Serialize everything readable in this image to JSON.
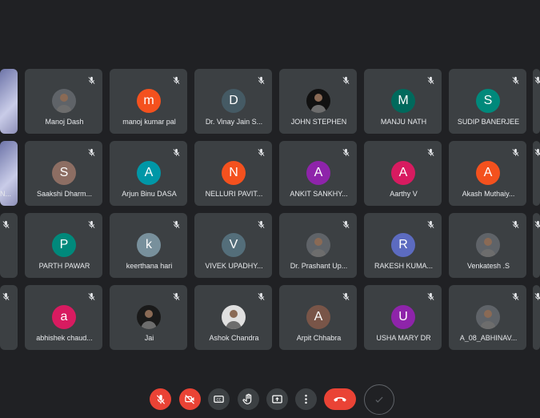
{
  "participants": [
    {
      "name": "",
      "initial": "",
      "color": "#5f6368",
      "photo": true,
      "icon": "photo-avatar"
    },
    {
      "name": "Manoj Dash",
      "initial": "",
      "color": "#5f6368",
      "photo": true,
      "icon": "photo-avatar"
    },
    {
      "name": "manoj kumar pal",
      "initial": "m",
      "color": "#f4511e",
      "photo": false
    },
    {
      "name": "Dr. Vinay Jain S...",
      "initial": "D",
      "color": "#455a64",
      "photo": false
    },
    {
      "name": "JOHN STEPHEN",
      "initial": "",
      "color": "#111111",
      "photo": true,
      "icon": "photo-avatar"
    },
    {
      "name": "MANJU NATH",
      "initial": "M",
      "color": "#00695c",
      "photo": false
    },
    {
      "name": "SUDIP BANERJEE",
      "initial": "S",
      "color": "#00897b",
      "photo": false
    },
    {
      "name": "",
      "initial": "",
      "color": "#3c4043",
      "photo": false
    },
    {
      "name": "N...",
      "initial": "",
      "color": "#5f6368",
      "photo": true,
      "icon": "photo-avatar"
    },
    {
      "name": "Saakshi Dharm...",
      "initial": "S",
      "color": "#8d6e63",
      "photo": false
    },
    {
      "name": "Arjun Binu DASA",
      "initial": "A",
      "color": "#0097a7",
      "photo": false
    },
    {
      "name": "NELLURI PAVIT...",
      "initial": "N",
      "color": "#f4511e",
      "photo": false
    },
    {
      "name": "ANKIT SANKHY...",
      "initial": "A",
      "color": "#8e24aa",
      "photo": false
    },
    {
      "name": "Aarthy V",
      "initial": "A",
      "color": "#d81b60",
      "photo": false
    },
    {
      "name": "Akash Muthaiy...",
      "initial": "A",
      "color": "#f4511e",
      "photo": false
    },
    {
      "name": "",
      "initial": "",
      "color": "#3c4043",
      "photo": false
    },
    {
      "name": "",
      "initial": "",
      "color": "#3c4043",
      "photo": false
    },
    {
      "name": "PARTH PAWAR",
      "initial": "P",
      "color": "#00897b",
      "photo": false
    },
    {
      "name": "keerthana hari",
      "initial": "k",
      "color": "#78909c",
      "photo": false
    },
    {
      "name": "VIVEK UPADHY...",
      "initial": "V",
      "color": "#546e7a",
      "photo": false
    },
    {
      "name": "Dr. Prashant Up...",
      "initial": "",
      "color": "#5f6368",
      "photo": true,
      "icon": "photo-avatar"
    },
    {
      "name": "RAKESH KUMA...",
      "initial": "R",
      "color": "#5c6bc0",
      "photo": false
    },
    {
      "name": "Venkatesh .S",
      "initial": "",
      "color": "#5f6368",
      "photo": true,
      "icon": "photo-avatar"
    },
    {
      "name": "",
      "initial": "",
      "color": "#3c4043",
      "photo": false
    },
    {
      "name": "",
      "initial": "",
      "color": "#3c4043",
      "photo": false
    },
    {
      "name": "abhishek chaud...",
      "initial": "a",
      "color": "#d81b60",
      "photo": false
    },
    {
      "name": "Jai",
      "initial": "",
      "color": "#1a1a1a",
      "photo": true,
      "icon": "photo-avatar"
    },
    {
      "name": "Ashok Chandra",
      "initial": "",
      "color": "#e0e0e0",
      "photo": true,
      "icon": "photo-avatar"
    },
    {
      "name": "Arpit Chhabra",
      "initial": "A",
      "color": "#795548",
      "photo": false
    },
    {
      "name": "USHA MARY DR",
      "initial": "U",
      "color": "#8e24aa",
      "photo": false
    },
    {
      "name": "A_08_ABHINAV...",
      "initial": "",
      "color": "#5f6368",
      "photo": true,
      "icon": "photo-avatar"
    },
    {
      "name": "",
      "initial": "",
      "color": "#3c4043",
      "photo": false
    }
  ],
  "toolbar": {
    "buttons": [
      {
        "icon": "mic-off-icon",
        "state": "off"
      },
      {
        "icon": "camera-off-icon",
        "state": "off"
      },
      {
        "icon": "captions-icon"
      },
      {
        "icon": "raise-hand-icon"
      },
      {
        "icon": "present-screen-icon"
      },
      {
        "icon": "more-options-icon"
      },
      {
        "icon": "leave-call-icon"
      },
      {
        "icon": "checkmark-icon"
      }
    ]
  },
  "colors": {
    "background": "#202124",
    "tile": "#3c4043",
    "danger": "#ea4335",
    "text": "#e8eaed"
  }
}
